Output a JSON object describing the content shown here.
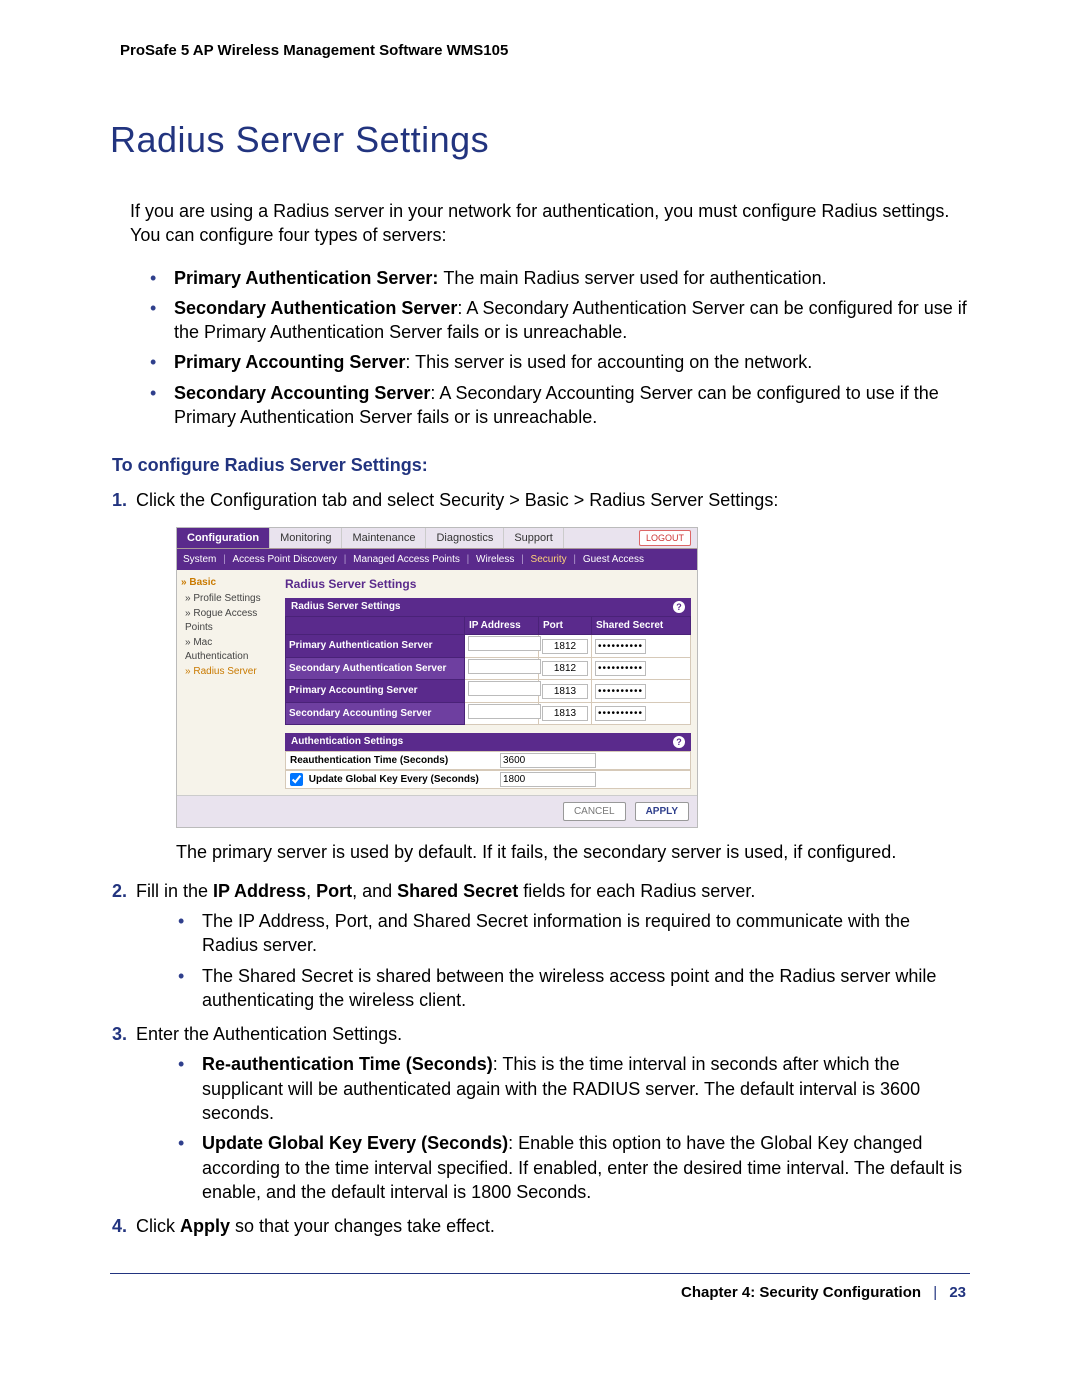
{
  "doc_header": "ProSafe 5 AP Wireless Management Software WMS105",
  "title": "Radius Server Settings",
  "intro": "If you are using a Radius server in your network for authentication, you must configure Radius settings. You can configure four types of servers:",
  "bullets": [
    {
      "bold": "Primary Authentication Server: ",
      "text": "The main Radius server used for authentication."
    },
    {
      "bold": "Secondary Authentication Server",
      "text": ": A Secondary Authentication Server can be configured for use if the Primary Authentication Server fails or is unreachable."
    },
    {
      "bold": "Primary Accounting Server",
      "text": ": This server is used for accounting on the network."
    },
    {
      "bold": "Secondary Accounting Server",
      "text": ": A Secondary Accounting Server can be configured to use if the Primary Authentication Server fails or is unreachable."
    }
  ],
  "subhead": "To configure Radius Server Settings:",
  "step1": "Click the Configuration tab and select Security > Basic > Radius Server Settings:",
  "after_shot": "The primary server is used by default. If it fails, the secondary server is used, if configured.",
  "step2_lead": "Fill in the ",
  "step2_f1": "IP Address",
  "step2_f2": "Port",
  "step2_f3": "Shared Secret",
  "step2_tail": " fields for each Radius server.",
  "step2_sub": [
    "The IP Address, Port, and Shared Secret information is required to communicate with the Radius server.",
    "The Shared Secret is shared between the wireless access point and the Radius server while authenticating the wireless client."
  ],
  "step3": "Enter the Authentication Settings.",
  "step3_sub": [
    {
      "bold": "Re-authentication Time (Seconds)",
      "text": ": This is the time interval in seconds after which the supplicant will be authenticated again with the RADIUS server. The default interval is 3600 seconds."
    },
    {
      "bold": "Update Global Key Every (Seconds)",
      "text": ": Enable this option to have the Global Key changed according to the time interval specified. If enabled, enter the desired time interval. The default is enable, and the default interval is 1800 Seconds."
    }
  ],
  "step4_lead": "Click ",
  "step4_bold": "Apply",
  "step4_tail": " so that your changes take effect.",
  "shot": {
    "tabs": [
      "Configuration",
      "Monitoring",
      "Maintenance",
      "Diagnostics",
      "Support"
    ],
    "logout": "LOGOUT",
    "subtabs": [
      "System",
      "Access Point Discovery",
      "Managed Access Points",
      "Wireless",
      "Security",
      "Guest Access"
    ],
    "sidebar": {
      "basic": "Basic",
      "items": [
        "Profile Settings",
        "Rogue Access Points",
        "Mac Authentication",
        "Radius Server"
      ]
    },
    "panel_title": "Radius Server Settings",
    "section1": "Radius Server Settings",
    "cols": [
      "IP Address",
      "Port",
      "Shared Secret"
    ],
    "rows": [
      {
        "label": "Primary Authentication Server",
        "ip": "",
        "port": "1812",
        "secret": "••••••••••"
      },
      {
        "label": "Secondary Authentication Server",
        "ip": "",
        "port": "1812",
        "secret": "••••••••••"
      },
      {
        "label": "Primary Accounting Server",
        "ip": "",
        "port": "1813",
        "secret": "••••••••••"
      },
      {
        "label": "Secondary Accounting Server",
        "ip": "",
        "port": "1813",
        "secret": "••••••••••"
      }
    ],
    "section2": "Authentication Settings",
    "auth": [
      {
        "label": "Reauthentication Time (Seconds)",
        "value": "3600",
        "check": false
      },
      {
        "label": "Update Global Key Every (Seconds)",
        "value": "1800",
        "check": true
      }
    ],
    "cancel": "CANCEL",
    "apply": "APPLY"
  },
  "footer": {
    "chapter": "Chapter 4:  Security Configuration",
    "page": "23"
  }
}
